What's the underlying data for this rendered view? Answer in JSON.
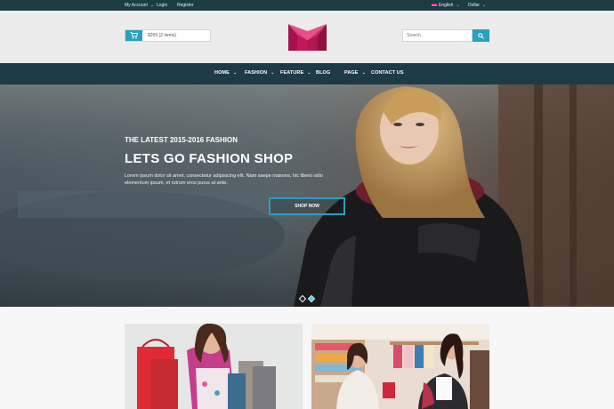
{
  "topbar": {
    "my_account": "My Account",
    "login": "Login",
    "register": "Register",
    "language": "English",
    "currency": "Dollar"
  },
  "header": {
    "cart_text": "$205 (2 items)",
    "search_placeholder": "Search...",
    "logo_letter": "M"
  },
  "nav": {
    "items": [
      {
        "label": "HOME",
        "dropdown": true
      },
      {
        "label": "FASHION",
        "dropdown": true
      },
      {
        "label": "FEATURE",
        "dropdown": true
      },
      {
        "label": "BLOG",
        "dropdown": false
      },
      {
        "label": "PAGE",
        "dropdown": true
      },
      {
        "label": "CONTACT US",
        "dropdown": false
      }
    ]
  },
  "hero": {
    "kicker": "THE LATEST 2015-2016 FASHION",
    "title": "LETS GO FASHION SHOP",
    "description": "Lorem ipsum dolor sit amet, consectetur adipisicing elit. Nam saepe maiores, hic libero odio elementum ipsum, et rutrum eros purus at ante.",
    "button_label": "SHOP NOW",
    "slides": 2,
    "active_slide": 2
  },
  "colors": {
    "accent": "#2aa0c0",
    "dark_bar": "#1d3b45",
    "logo_pink": "#c2185b"
  }
}
